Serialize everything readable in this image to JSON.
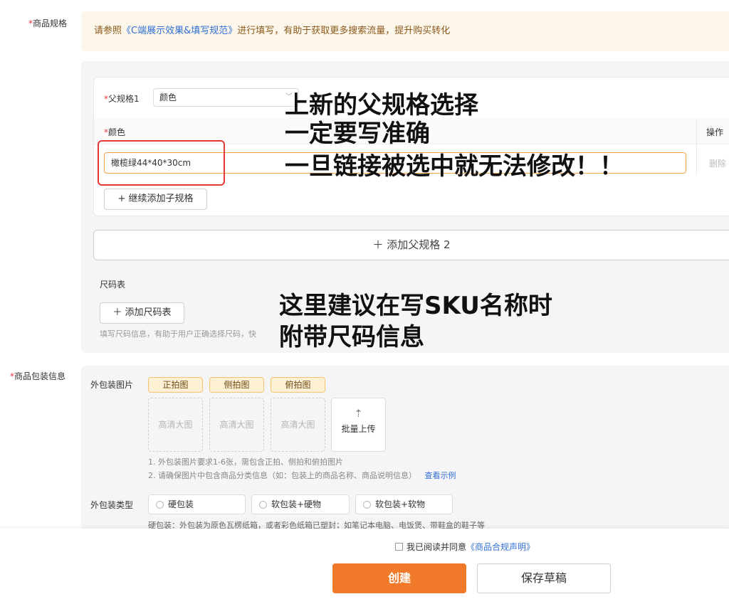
{
  "spec_section": {
    "label": "商品规格",
    "tip_prefix": "请参照",
    "tip_link": "《C端展示效果&填写规范》",
    "tip_suffix": "进行填写，有助于获取更多搜索流量，提升购买转化",
    "parent_spec_label": "父规格1",
    "parent_spec_value": "颜色",
    "column_header": "颜色",
    "action_header": "操作",
    "sub_spec_value": "橄榄绿44*40*30cm",
    "delete_label": "删除",
    "add_child_button": "+ 继续添加子规格",
    "add_parent_button": "＋ 添加父规格 2",
    "size_chart_label": "尺码表",
    "add_size_chart_button": "＋ 添加尺码表",
    "size_chart_hint": "填写尺码信息，有助于用户正确选择尺码，快"
  },
  "annotations": {
    "top_line1": "上新的父规格选择",
    "top_line2": "一定要写准确",
    "top_line3": "一旦链接被选中就无法修改！！",
    "bottom_line1": "这里建议在写SKU名称时",
    "bottom_line2": "附带尺码信息"
  },
  "package_section": {
    "label": "商品包装信息",
    "images_label": "外包装图片",
    "tags": [
      "正拍图",
      "侧拍图",
      "俯拍图"
    ],
    "placeholder": "高清大图",
    "batch_upload": "批量上传",
    "note1": "1. 外包装图片要求1-6张，需包含正拍、侧拍和俯拍图片",
    "note2": "2. 请确保图片中包含商品分类信息（如：包装上的商品名称、商品说明信息）",
    "example_link": "查看示例",
    "type_label": "外包装类型",
    "types": [
      "硬包装",
      "软包装+硬物",
      "软包装+软物"
    ],
    "type_note": "硬包装：外包装为原色瓦楞纸箱，或者彩色纸箱已塑封；如笔记本电脑、电饭煲、带鞋盒的鞋子等"
  },
  "footer": {
    "agree_text": "我已阅读并同意",
    "agree_link": "《商品合规声明》",
    "create_button": "创建",
    "draft_button": "保存草稿"
  },
  "colors": {
    "accent": "#f07a2a",
    "highlight": "#e53935",
    "link": "#2f6fd6"
  }
}
